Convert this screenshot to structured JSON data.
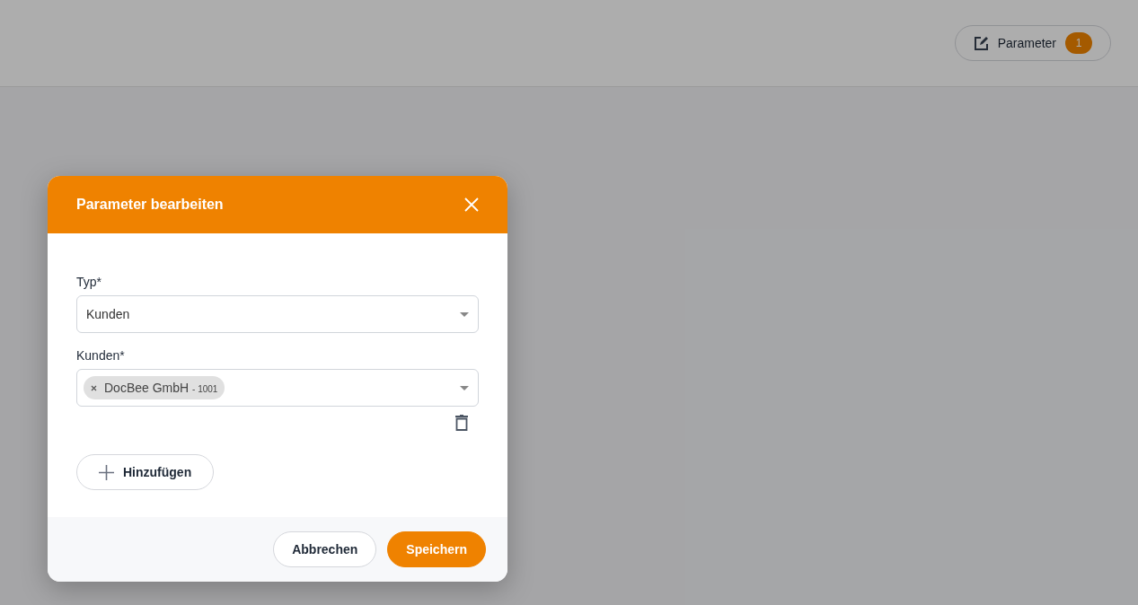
{
  "header": {
    "button": {
      "label": "Parameter",
      "count": "1"
    }
  },
  "dialog": {
    "title": "Parameter bearbeiten",
    "fields": [
      {
        "kind": "select",
        "label": "Typ*",
        "value": "Kunden"
      },
      {
        "kind": "multiselect",
        "label": "Kunden*",
        "chips": [
          {
            "name": "DocBee GmbH",
            "code": "- 1001"
          }
        ]
      }
    ],
    "add_button": "Hinzufügen",
    "buttons": [
      {
        "label": "Abbrechen",
        "kind": "secondary"
      },
      {
        "label": "Speichern",
        "kind": "primary"
      }
    ]
  }
}
